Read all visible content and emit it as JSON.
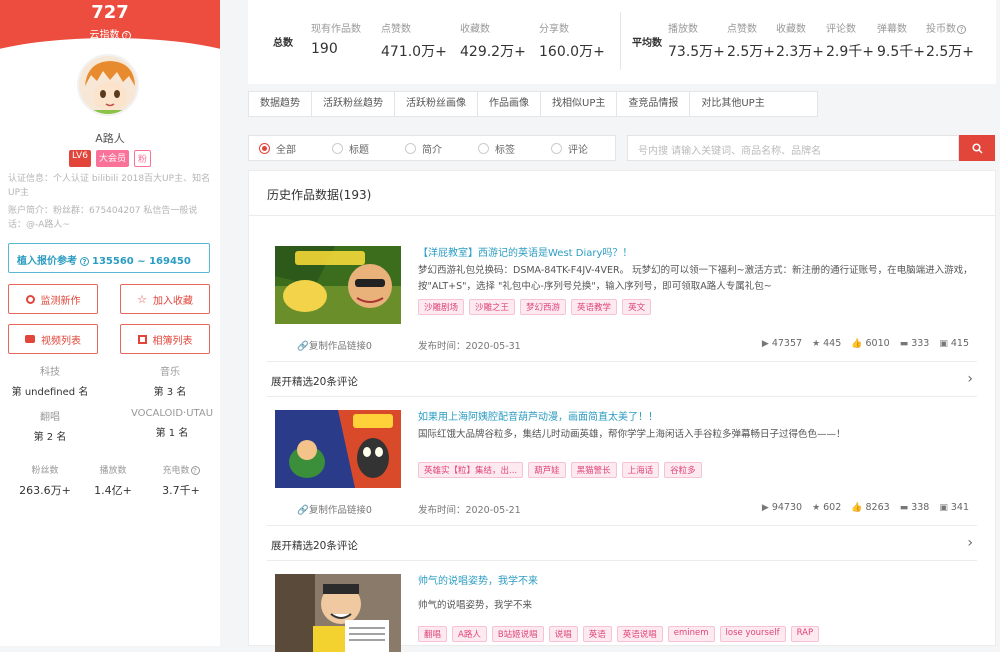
{
  "profile": {
    "score": "727",
    "score_label": "云指数",
    "name": "A路人",
    "badges": [
      "LV6",
      "大会员",
      "粉"
    ],
    "cert": "认证信息：个人认证 bilibili 2018百大UP主、知名UP主",
    "intro": "账户简介：粉丝群：675404207 私信告一般说话：@-A路人~",
    "quote": "植入报价参考",
    "quote_range": "135560 ~ 169450",
    "buttons": [
      "监测新作",
      "加入收藏",
      "视频列表",
      "相簿列表"
    ],
    "ranks": [
      {
        "label": "科技",
        "value": "第 undefined 名"
      },
      {
        "label": "音乐",
        "value": "第 3 名"
      },
      {
        "label": "翻唱",
        "value": "第 2 名"
      },
      {
        "label": "VOCALOID·UTAU",
        "value": "第 1 名"
      }
    ],
    "fans": [
      {
        "label": "粉丝数",
        "value": "263.6万+"
      },
      {
        "label": "播放数",
        "value": "1.4亿+"
      },
      {
        "label": "充电数",
        "value": "3.7千+"
      }
    ]
  },
  "summary": {
    "total_label": "总数",
    "avg_label": "平均数",
    "totals": [
      {
        "label": "现有作品数",
        "value": "190"
      },
      {
        "label": "点赞数",
        "value": "471.0万+"
      },
      {
        "label": "收藏数",
        "value": "429.2万+"
      },
      {
        "label": "分享数",
        "value": "160.0万+"
      }
    ],
    "averages": [
      {
        "label": "播放数",
        "value": "73.5万+"
      },
      {
        "label": "点赞数",
        "value": "2.5万+"
      },
      {
        "label": "收藏数",
        "value": "2.3万+"
      },
      {
        "label": "评论数",
        "value": "2.9千+"
      },
      {
        "label": "弹幕数",
        "value": "9.5千+"
      },
      {
        "label": "投币数",
        "value": "2.5万+"
      }
    ]
  },
  "tabs": [
    "数据趋势",
    "活跃粉丝趋势",
    "活跃粉丝画像",
    "作品画像",
    "找相似UP主",
    "查竞品情报",
    "对比其他UP主"
  ],
  "filter": {
    "options": [
      "全部",
      "标题",
      "简介",
      "标签",
      "评论"
    ],
    "selected": "全部",
    "search_placeholder": "号内搜  请输入关键词、商品名称、品牌名"
  },
  "history": {
    "title": "历史作品数据(193)",
    "copy_label": "复制作品链接0",
    "pub_prefix": "发布时间：",
    "expand_label": "展开精选20条评论",
    "videos": [
      {
        "title": "【洋屁教室】西游记的英语是West Diary吗？！",
        "desc": "梦幻西游礼包兑换码：DSMA-84TK-F4JV-4VER。 玩梦幻的可以领一下福利~激活方式：新注册的通行证账号，在电脑端进入游戏，按\"ALT+S\"，选择 \"礼包中心-序列号兑换\"，输入序列号，即可领取A路人专属礼包~",
        "tags": [
          "沙雕剧场",
          "沙雕之王",
          "梦幻西游",
          "英语教学",
          "英文"
        ],
        "date": "2020-05-31",
        "stats": [
          "47357",
          "445",
          "6010",
          "333",
          "415"
        ]
      },
      {
        "title": "如果用上海阿姨腔配音葫芦动漫，画面简直太美了！！",
        "desc": "国际红饿大品牌谷粒多，集结儿时动画英雄，帮你学学上海闲话入手谷粒多弹幕畅日子过得色色——！",
        "tags": [
          "英雄实【粒】集结，出...",
          "葫芦娃",
          "黑猫警长",
          "上海话",
          "谷粒多"
        ],
        "date": "2020-05-21",
        "stats": [
          "94730",
          "602",
          "8263",
          "338",
          "341"
        ]
      },
      {
        "title": "帅气的说唱姿势，我学不来",
        "desc": "帅气的说唱姿势，我学不来",
        "tags": [
          "翻唱",
          "A路人",
          "B站姬说唱",
          "说唱",
          "英语",
          "英语说唱",
          "eminem",
          "lose yourself",
          "RAP"
        ]
      }
    ]
  },
  "colors": {
    "accent": "#e2453a",
    "link": "#2c9dc2",
    "tag": "#e0457b"
  }
}
